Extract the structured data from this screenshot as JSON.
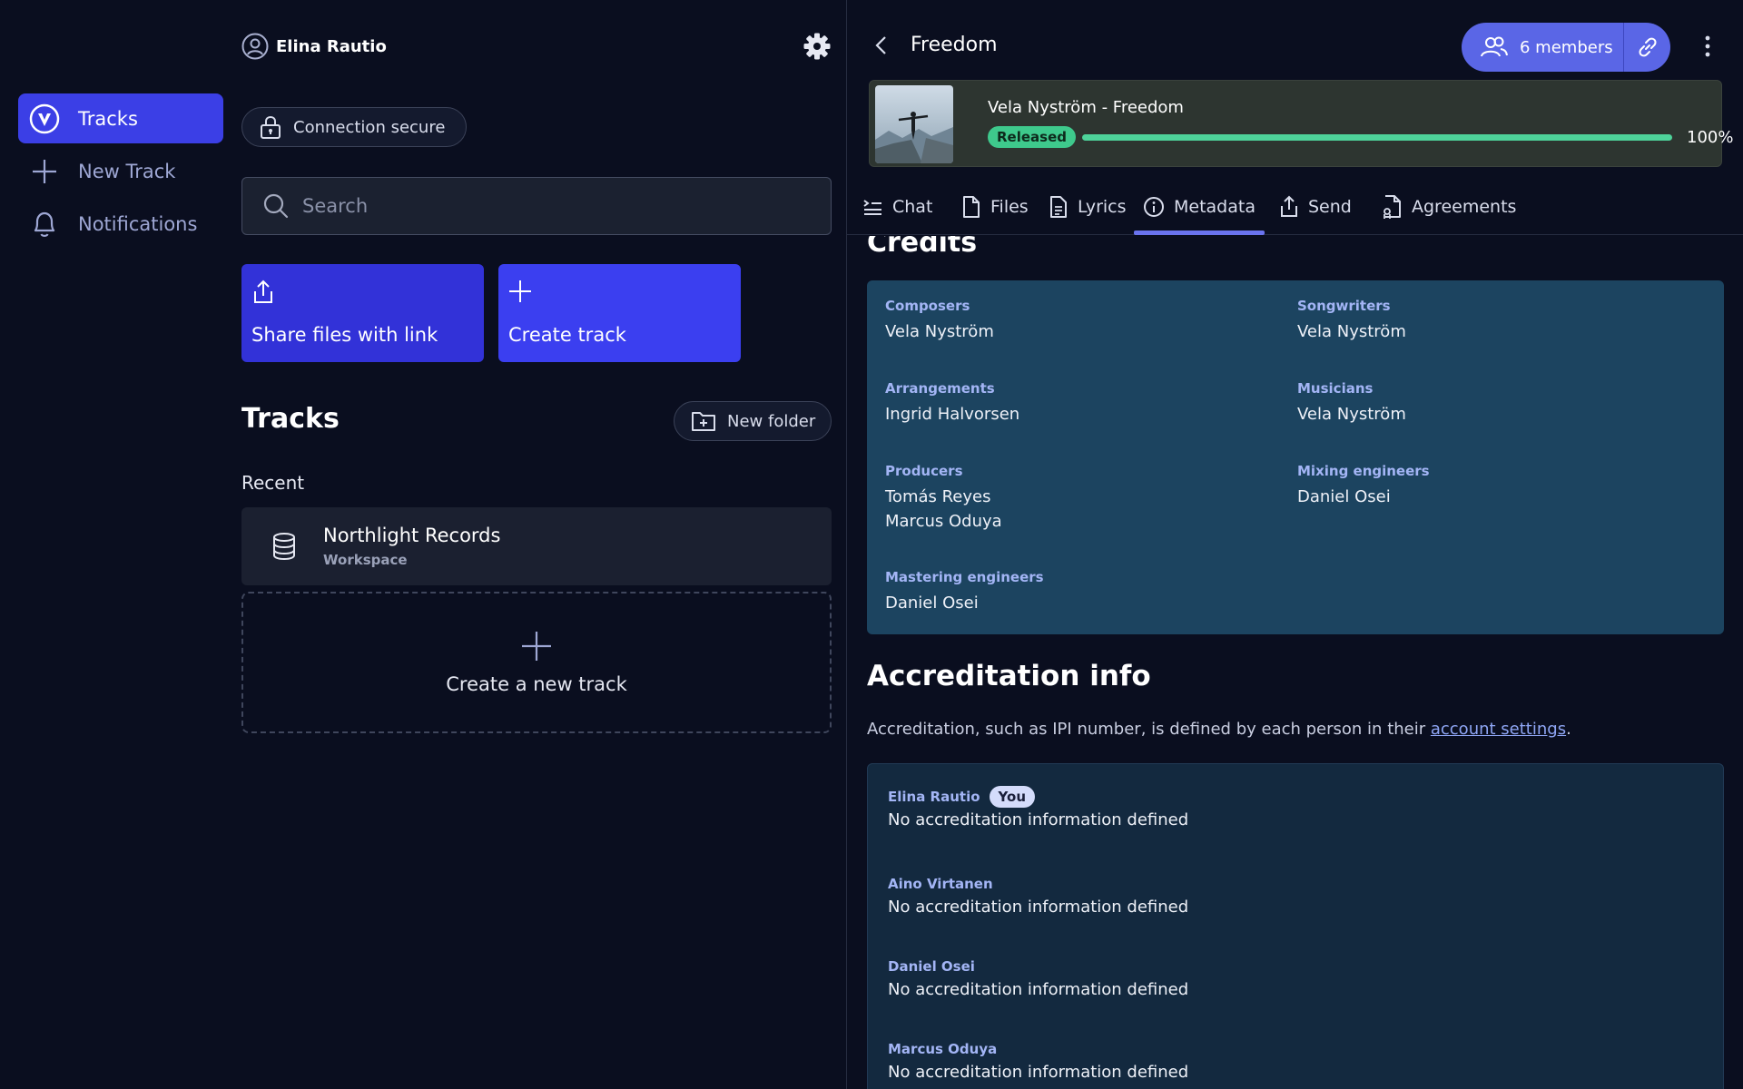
{
  "nav": {
    "items": [
      {
        "label": "Tracks",
        "icon": "logo-v-icon",
        "active": true
      },
      {
        "label": "New Track",
        "icon": "plus-icon",
        "active": false
      },
      {
        "label": "Notifications",
        "icon": "bell-icon",
        "active": false
      }
    ]
  },
  "user": {
    "name": "Elina Rautio"
  },
  "connection": {
    "label": "Connection secure"
  },
  "search": {
    "placeholder": "Search",
    "value": ""
  },
  "actions": {
    "share_label": "Share files with link",
    "create_label": "Create track"
  },
  "tracks": {
    "title": "Tracks",
    "new_folder_label": "New folder",
    "recent_label": "Recent",
    "workspace": {
      "name": "Northlight Records",
      "type": "Workspace"
    },
    "create_new_label": "Create a new track"
  },
  "track_panel": {
    "title": "Freedom",
    "members_label": "6 members",
    "track_name": "Vela Nyström - Freedom",
    "status": "Released",
    "progress": 100,
    "progress_label": "100%",
    "tabs": [
      {
        "label": "Chat",
        "icon": "chat-lines-icon",
        "active": false
      },
      {
        "label": "Files",
        "icon": "file-icon",
        "active": false
      },
      {
        "label": "Lyrics",
        "icon": "document-icon",
        "active": false
      },
      {
        "label": "Metadata",
        "icon": "info-icon",
        "active": true
      },
      {
        "label": "Send",
        "icon": "upload-icon",
        "active": false
      },
      {
        "label": "Agreements",
        "icon": "agreement-icon",
        "active": false
      }
    ]
  },
  "credits": {
    "title": "Credits",
    "composers": {
      "label": "Composers",
      "values": [
        "Vela Nyström"
      ]
    },
    "songwriters": {
      "label": "Songwriters",
      "values": [
        "Vela Nyström"
      ]
    },
    "arrangements": {
      "label": "Arrangements",
      "values": [
        "Ingrid Halvorsen"
      ]
    },
    "musicians": {
      "label": "Musicians",
      "values": [
        "Vela Nyström"
      ]
    },
    "producers": {
      "label": "Producers",
      "values": [
        "Tomás Reyes",
        "Marcus Oduya"
      ]
    },
    "mixing": {
      "label": "Mixing engineers",
      "values": [
        "Daniel Osei"
      ]
    },
    "mastering": {
      "label": "Mastering engineers",
      "values": [
        "Daniel Osei"
      ]
    }
  },
  "accreditation": {
    "title": "Accreditation info",
    "desc_prefix": "Accreditation, such as IPI number, is defined by each person in their ",
    "desc_link": "account settings",
    "desc_suffix": ".",
    "you_badge": "You",
    "people": [
      {
        "name": "Elina Rautio",
        "value": "No accreditation information defined"
      },
      {
        "name": "Aino Virtanen",
        "value": "No accreditation information defined"
      },
      {
        "name": "Daniel Osei",
        "value": "No accreditation information defined"
      },
      {
        "name": "Marcus Oduya",
        "value": "No accreditation information defined"
      }
    ]
  },
  "colors": {
    "accent": "#3b3fe6",
    "released": "#3ec98c",
    "credits_bg": "#1c4460"
  }
}
